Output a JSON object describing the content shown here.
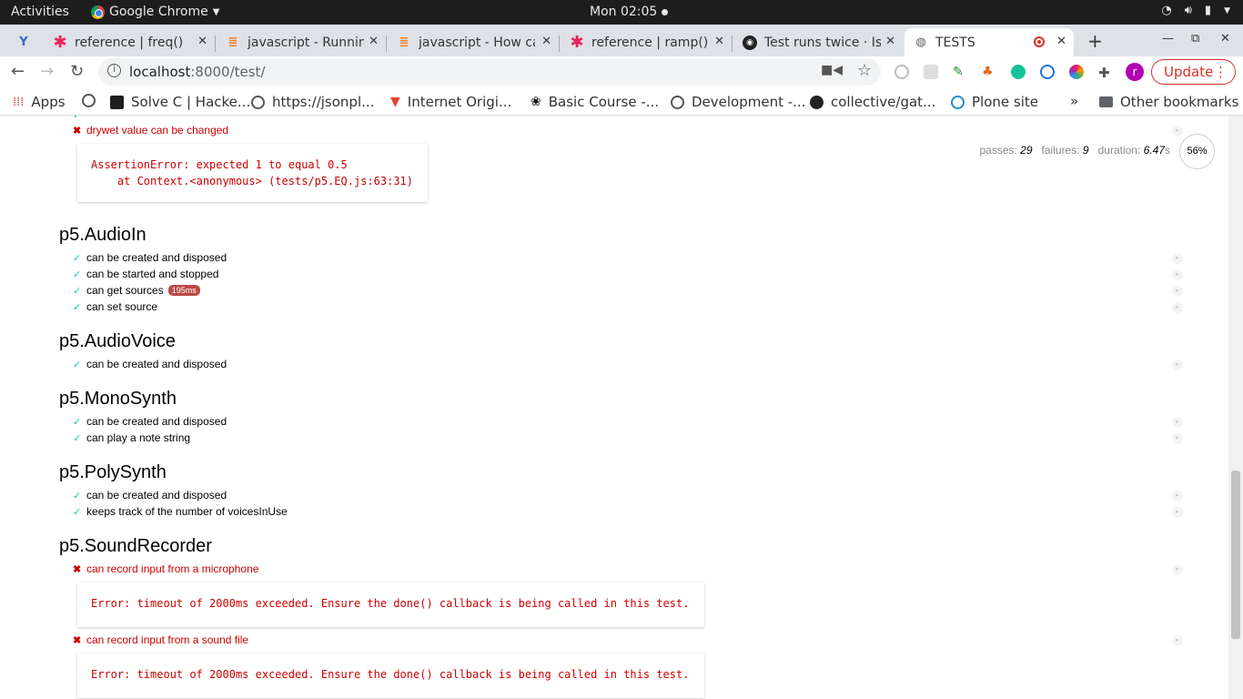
{
  "system_bar": {
    "activities": "Activities",
    "app_name": "Google Chrome",
    "clock": "Mon 02:05"
  },
  "tabs": [
    {
      "title": "reference | freq()",
      "icon": "p5-asterisk-icon"
    },
    {
      "title": "javascript - Running",
      "icon": "stackoverflow-icon"
    },
    {
      "title": "javascript - How ca",
      "icon": "stackoverflow-icon"
    },
    {
      "title": "reference | ramp()",
      "icon": "p5-asterisk-icon"
    },
    {
      "title": "Test runs twice · Is",
      "icon": "github-icon"
    },
    {
      "title": "TESTS",
      "icon": "globe-icon"
    }
  ],
  "toolbar": {
    "url_host": "localhost",
    "url_path": ":8000/test/",
    "avatar_letter": "r",
    "update_label": "Update"
  },
  "bookmarks": [
    {
      "label": "Apps"
    },
    {
      "label": ""
    },
    {
      "label": "Solve C | Hacke..."
    },
    {
      "label": "https://jsonpl..."
    },
    {
      "label": "Internet Origi..."
    },
    {
      "label": "Basic Course -..."
    },
    {
      "label": "Development -..."
    },
    {
      "label": "collective/gat..."
    },
    {
      "label": "Plone site"
    }
  ],
  "other_bookmarks": "Other bookmarks",
  "report": {
    "passes_label": "passes:",
    "passes": "29",
    "failures_label": "failures:",
    "failures": "9",
    "duration_label": "duration:",
    "duration": "6.47",
    "duration_unit": "s",
    "progress": "56%",
    "progress_fraction": 0.56
  },
  "top_failure": {
    "title": "drywet value can be changed",
    "error": "AssertionError: expected 1 to equal 0.5\n    at Context.<anonymous> (tests/p5.EQ.js:63:31)"
  },
  "suites": [
    {
      "title": "p5.AudioIn",
      "tests": [
        {
          "title": "can be created and disposed"
        },
        {
          "title": "can be started and stopped"
        },
        {
          "title": "can get sources",
          "badge": "195ms"
        },
        {
          "title": "can set source"
        }
      ]
    },
    {
      "title": "p5.AudioVoice",
      "tests": [
        {
          "title": "can be created and disposed"
        }
      ]
    },
    {
      "title": "p5.MonoSynth",
      "tests": [
        {
          "title": "can be created and disposed"
        },
        {
          "title": "can play a note string"
        }
      ]
    },
    {
      "title": "p5.PolySynth",
      "tests": [
        {
          "title": "can be created and disposed"
        },
        {
          "title": "keeps track of the number of voicesInUse"
        }
      ]
    },
    {
      "title": "p5.SoundRecorder",
      "tests": [
        {
          "title": "can record input from a microphone",
          "error": "Error: timeout of 2000ms exceeded. Ensure the done() callback is being called in this test."
        },
        {
          "title": "can record input from a sound file",
          "error": "Error: timeout of 2000ms exceeded. Ensure the done() callback is being called in this test."
        }
      ]
    }
  ]
}
